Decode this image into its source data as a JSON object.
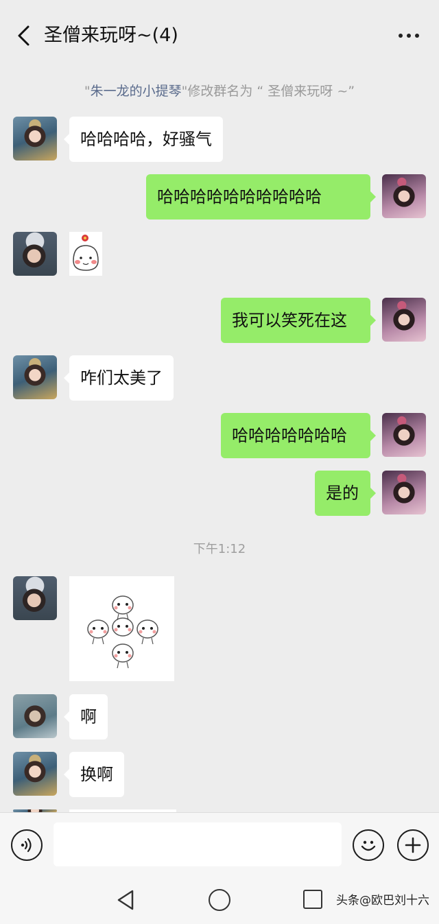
{
  "header": {
    "title": "圣僧来玩呀~(4)",
    "back_icon": "chevron-left-icon",
    "more_icon": "more-dots-icon"
  },
  "system_notice": {
    "prefix_quote": "\"",
    "name": "朱一龙的小提琴",
    "suffix": "\"修改群名为 “ 圣僧来玩呀 ~”"
  },
  "messages": [
    {
      "side": "left",
      "avatar": "costume-avatar-a",
      "text": "哈哈哈哈，好骚气"
    },
    {
      "side": "right",
      "avatar": "costume-avatar-c",
      "text": "哈哈哈哈哈哈哈哈哈哈"
    },
    {
      "side": "left",
      "avatar": "costume-avatar-b",
      "sticker": "flower-blush-face-sticker"
    },
    {
      "side": "right",
      "avatar": "costume-avatar-c",
      "text": "我可以笑死在这"
    },
    {
      "side": "left",
      "avatar": "costume-avatar-a",
      "text": "咋们太美了"
    },
    {
      "side": "right",
      "avatar": "costume-avatar-c",
      "text": "哈哈哈哈哈哈哈"
    },
    {
      "side": "right",
      "avatar": "costume-avatar-c",
      "text": "是的"
    },
    {
      "side": "left",
      "avatar": "costume-avatar-b",
      "sticker": "five-heads-sticker"
    },
    {
      "side": "left",
      "avatar": "costume-avatar-d",
      "text": "啊"
    },
    {
      "side": "left",
      "avatar": "costume-avatar-a",
      "text": "换啊"
    }
  ],
  "timestamp": "下午1:12",
  "input_bar": {
    "voice_icon": "voice-icon",
    "emoji_icon": "emoji-icon",
    "plus_icon": "plus-icon",
    "placeholder": ""
  },
  "nav": {
    "back_icon": "nav-back-icon",
    "home_icon": "nav-home-icon",
    "recent_icon": "nav-recent-icon"
  },
  "watermark": "头条@欧巴刘十六",
  "colors": {
    "background": "#ededed",
    "bubble_right": "#95ec69",
    "bubble_left": "#ffffff",
    "name_link": "#5a6b8c"
  }
}
